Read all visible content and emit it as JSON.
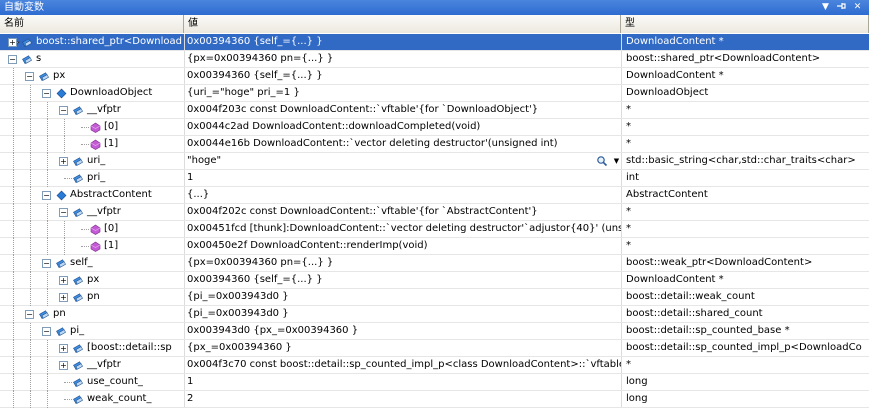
{
  "window": {
    "title": "自動変数"
  },
  "columns": {
    "name": "名前",
    "value": "値",
    "type": "型"
  },
  "colors": {
    "selection": "#316ac5",
    "titlebar": "#3a78d8"
  },
  "rows": [
    {
      "name": "boost::shared_ptr<Download",
      "value": "0x00394360 {self_={...} }",
      "type": "DownloadContent *",
      "depth": 0,
      "expander": "+",
      "icon": "field-icon",
      "selected": true,
      "arrow": true
    },
    {
      "name": "s",
      "value": "{px=0x00394360 pn={...} }",
      "type": "boost::shared_ptr<DownloadContent>",
      "depth": 0,
      "expander": "−",
      "icon": "field-icon"
    },
    {
      "name": "px",
      "value": "0x00394360 {self_={...} }",
      "type": "DownloadContent *",
      "depth": 1,
      "expander": "−",
      "icon": "field-icon"
    },
    {
      "name": "DownloadObject",
      "value": "{uri_=\"hoge\" pri_=1 }",
      "type": "DownloadObject",
      "depth": 2,
      "expander": "−",
      "icon": "class-icon"
    },
    {
      "name": "__vfptr",
      "value": "0x004f203c const DownloadContent::`vftable'{for `DownloadObject'}",
      "type": "*",
      "depth": 3,
      "expander": "−",
      "icon": "field-icon"
    },
    {
      "name": "[0]",
      "value": "0x0044c2ad DownloadContent::downloadCompleted(void)",
      "type": "*",
      "depth": 4,
      "expander": "",
      "icon": "method-icon"
    },
    {
      "name": "[1]",
      "value": "0x0044e16b DownloadContent::`vector deleting destructor'(unsigned int)",
      "type": "*",
      "depth": 4,
      "expander": "",
      "icon": "method-icon"
    },
    {
      "name": "uri_",
      "value": "\"hoge\"",
      "type": "std::basic_string<char,std::char_traits<char>",
      "depth": 3,
      "expander": "+",
      "icon": "field-icon",
      "viewer": true
    },
    {
      "name": "pri_",
      "value": "1",
      "type": "int",
      "depth": 3,
      "expander": "",
      "icon": "field-icon"
    },
    {
      "name": "AbstractContent",
      "value": "{...}",
      "type": "AbstractContent",
      "depth": 2,
      "expander": "−",
      "icon": "class-icon"
    },
    {
      "name": "__vfptr",
      "value": "0x004f202c const DownloadContent::`vftable'{for `AbstractContent'}",
      "type": "*",
      "depth": 3,
      "expander": "−",
      "icon": "field-icon"
    },
    {
      "name": "[0]",
      "value": "0x00451fcd [thunk]:DownloadContent::`vector deleting destructor'`adjustor{40}' (unsigne",
      "type": "*",
      "depth": 4,
      "expander": "",
      "icon": "method-icon"
    },
    {
      "name": "[1]",
      "value": "0x00450e2f DownloadContent::renderImp(void)",
      "type": "*",
      "depth": 4,
      "expander": "",
      "icon": "method-icon"
    },
    {
      "name": "self_",
      "value": "{px=0x00394360 pn={...} }",
      "type": "boost::weak_ptr<DownloadContent>",
      "depth": 2,
      "expander": "−",
      "icon": "field-icon"
    },
    {
      "name": "px",
      "value": "0x00394360 {self_={...} }",
      "type": "DownloadContent *",
      "depth": 3,
      "expander": "+",
      "icon": "field-icon"
    },
    {
      "name": "pn",
      "value": "{pi_=0x003943d0 }",
      "type": "boost::detail::weak_count",
      "depth": 3,
      "expander": "+",
      "icon": "field-icon"
    },
    {
      "name": "pn",
      "value": "{pi_=0x003943d0 }",
      "type": "boost::detail::shared_count",
      "depth": 1,
      "expander": "−",
      "icon": "field-icon"
    },
    {
      "name": "pi_",
      "value": "0x003943d0 {px_=0x00394360 }",
      "type": "boost::detail::sp_counted_base *",
      "depth": 2,
      "expander": "−",
      "icon": "field-icon"
    },
    {
      "name": "[boost::detail::sp",
      "value": "{px_=0x00394360 }",
      "type": "boost::detail::sp_counted_impl_p<DownloadCo",
      "depth": 3,
      "expander": "+",
      "icon": "field-icon"
    },
    {
      "name": "__vfptr",
      "value": "0x004f3c70 const boost::detail::sp_counted_impl_p<class DownloadContent>::`vftable'",
      "type": "*",
      "depth": 3,
      "expander": "+",
      "icon": "field-icon"
    },
    {
      "name": "use_count_",
      "value": "1",
      "type": "long",
      "depth": 3,
      "expander": "",
      "icon": "field-icon"
    },
    {
      "name": "weak_count_",
      "value": "2",
      "type": "long",
      "depth": 3,
      "expander": "",
      "icon": "field-icon"
    }
  ]
}
